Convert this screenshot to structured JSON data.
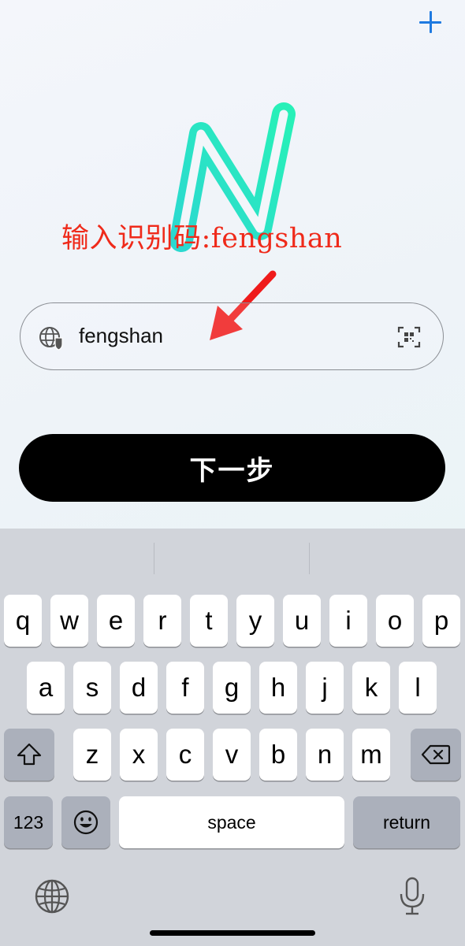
{
  "annotation": {
    "text": "输入识别码:fengshan",
    "color": "#ef2a1a"
  },
  "input": {
    "value": "fengshan"
  },
  "next_button": {
    "label": "下一步"
  },
  "keyboard": {
    "row1": [
      "q",
      "w",
      "e",
      "r",
      "t",
      "y",
      "u",
      "i",
      "o",
      "p"
    ],
    "row2": [
      "a",
      "s",
      "d",
      "f",
      "g",
      "h",
      "j",
      "k",
      "l"
    ],
    "row3": [
      "z",
      "x",
      "c",
      "v",
      "b",
      "n",
      "m"
    ],
    "numbers_label": "123",
    "space_label": "space",
    "return_label": "return"
  },
  "icons": {
    "add": "plus-icon",
    "site": "globe-shield-icon",
    "scan": "qr-scan-icon",
    "shift": "shift-icon",
    "delete": "backspace-icon",
    "emoji": "emoji-icon",
    "language": "globe-icon",
    "dictation": "microphone-icon"
  },
  "colors": {
    "accent": "#1f7ae0",
    "logo_teal": "#21e8c4",
    "button_bg": "#000000"
  }
}
